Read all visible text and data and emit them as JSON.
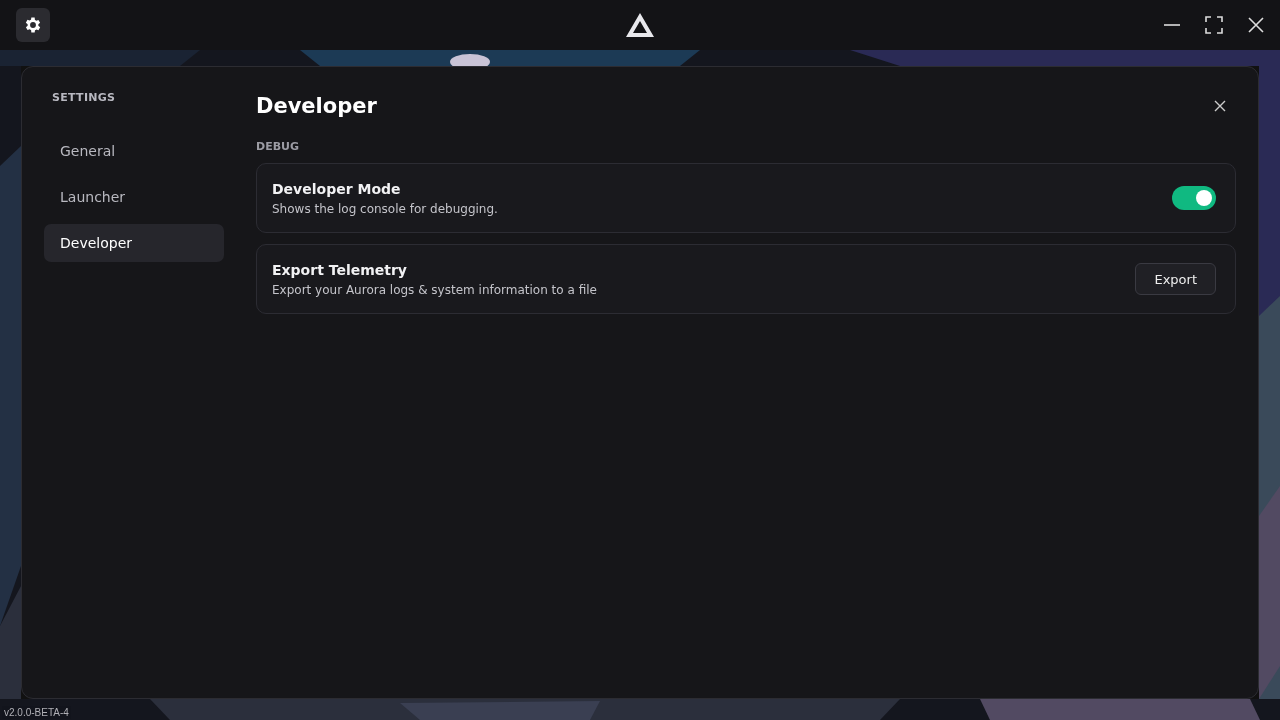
{
  "background": {
    "kind": "picture",
    "version": "v2.0.0-BETA-4"
  },
  "settings": {
    "heading": "SETTINGS",
    "nav": [
      {
        "label": "General",
        "selected": false
      },
      {
        "label": "Launcher",
        "selected": false
      },
      {
        "label": "Developer",
        "selected": true
      }
    ],
    "page_title": "Developer",
    "section": "DEBUG",
    "rows": [
      {
        "kind": "toggle",
        "title": "Developer Mode",
        "description": "Shows the log console for debugging.",
        "on": true
      },
      {
        "kind": "button",
        "title": "Export Telemetry",
        "description": "Export your Aurora logs & system information to a file",
        "button": "Export"
      }
    ]
  }
}
